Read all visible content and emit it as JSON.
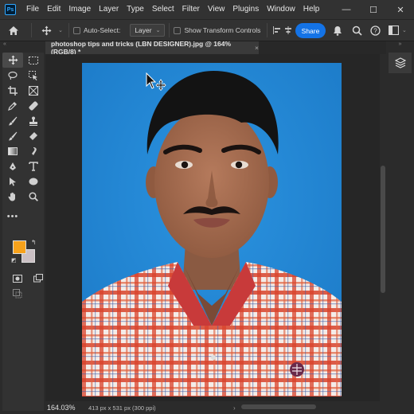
{
  "app": {
    "logo_text": "Ps"
  },
  "menu": [
    "File",
    "Edit",
    "Image",
    "Layer",
    "Type",
    "Select",
    "Filter",
    "View",
    "Plugins",
    "Window",
    "Help"
  ],
  "window_controls": {
    "minimize": "—",
    "maximize": "☐",
    "close": "✕"
  },
  "options_bar": {
    "auto_select_label": "Auto-Select:",
    "layer_select_value": "Layer",
    "transform_label": "Show Transform Controls",
    "share_label": "Share"
  },
  "document": {
    "tab_title": "photoshop tips and tricks (LBN DESIGNER).jpg @ 164% (RGB/8) *",
    "close": "×",
    "zoom": "164.03%",
    "doc_size": "413 px x 531 px (300 ppi)"
  },
  "colors": {
    "foreground": "#f7a21b",
    "background": "#cbc0c4",
    "photo_background": "#1f85d4",
    "share_button": "#1473e6"
  }
}
